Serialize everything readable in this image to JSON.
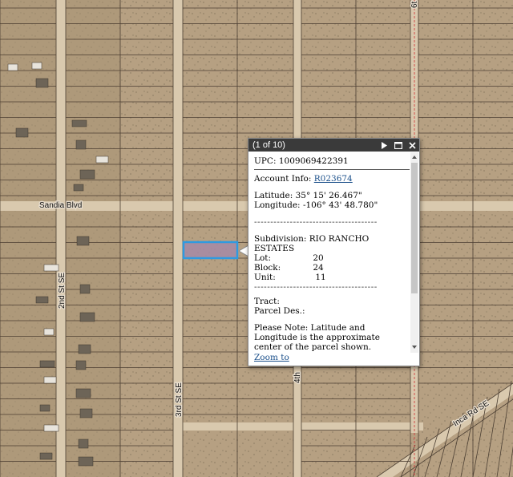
{
  "map": {
    "roads": [
      {
        "name": "Sandia Blvd"
      },
      {
        "name": "2nd St SE"
      },
      {
        "name": "3rd St SE"
      },
      {
        "name": "4th"
      },
      {
        "name": "6t"
      },
      {
        "name": "Inca Rd SE"
      }
    ],
    "colors": {
      "ground": "#b6a082",
      "parcel_line": "#4b3e32",
      "selection": "#2f9ae0",
      "selection_fill": "#a68aa6",
      "county_line": "#d04040"
    }
  },
  "popup": {
    "title": "(1 of 10)",
    "upc_label": "UPC:",
    "upc_value": "1009069422391",
    "account_label": "Account Info:",
    "account_value": "R023674",
    "latitude_label": "Latitude:",
    "latitude_value": "35° 15' 26.467\"",
    "longitude_label": "Longitude:",
    "longitude_value": "-106° 43' 48.780\"",
    "divider": "--------------------------------------",
    "subdivision_label": "Subdivision:",
    "subdivision_value_line1": "RIO RANCHO",
    "subdivision_value_line2": "ESTATES",
    "lot_label": "Lot:",
    "lot_value": "20",
    "block_label": "Block:",
    "block_value": "24",
    "unit_label": "Unit:",
    "unit_value": "11",
    "tract_label": "Tract:",
    "parcel_label": "Parcel Des.:",
    "note": "Please Note: Latitude and Longitude is the approximate center of the parcel shown.",
    "zoom_link": "Zoom to",
    "icons": [
      "next-icon",
      "maximize-icon",
      "close-icon"
    ]
  }
}
